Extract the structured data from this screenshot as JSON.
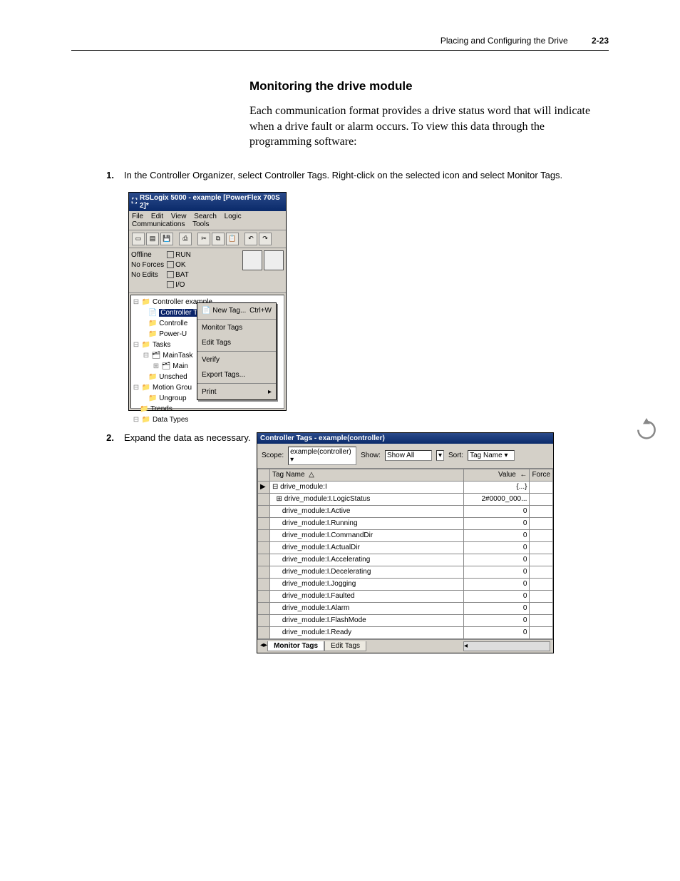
{
  "header": {
    "chapter": "Placing and Configuring the Drive",
    "page": "2-23"
  },
  "section": {
    "title": "Monitoring the drive module"
  },
  "body": {
    "p1": "Each communication format provides a drive status word that will indicate when a drive fault or alarm occurs. To view this data through the programming software:"
  },
  "steps": {
    "s1_num": "1.",
    "s1_text": "In the Controller Organizer, select Controller Tags. Right-click on the selected icon and select Monitor Tags.",
    "s2_num": "2.",
    "s2_text": "Expand the data as necessary."
  },
  "win1": {
    "title": "RSLogix 5000 - example [PowerFlex 700S 2]*",
    "menu": {
      "file": "File",
      "edit": "Edit",
      "view": "View",
      "search": "Search",
      "logic": "Logic",
      "comm": "Communications",
      "tools": "Tools"
    },
    "status": {
      "offline": "Offline",
      "noforces": "No Forces",
      "noedits": "No Edits",
      "run": "RUN",
      "ok": "OK",
      "bat": "BAT",
      "io": "I/O"
    },
    "tree": {
      "root": "Controller example",
      "ctags": "Controller Tags",
      "controllc": "Controlle",
      "poweru": "Power-U",
      "tasks": "Tasks",
      "maintask": "MainTask",
      "main": "Main",
      "unsched": "Unsched",
      "motion": "Motion Grou",
      "ungroup": "Ungroup",
      "trends": "Trends",
      "datatypes": "Data Types"
    },
    "ctx": {
      "newtag": "New Tag...",
      "newtag_sc": "Ctrl+W",
      "monitor": "Monitor Tags",
      "edit": "Edit Tags",
      "verify": "Verify",
      "export": "Export Tags...",
      "print": "Print"
    }
  },
  "win2": {
    "title": "Controller Tags - example(controller)",
    "filter": {
      "scope": "Scope:",
      "scope_val": "example(controller)",
      "show": "Show:",
      "show_val": "Show All",
      "sort": "Sort:",
      "sort_val": "Tag Name"
    },
    "cols": {
      "tagname": "Tag Name",
      "value": "Value",
      "force": "Force"
    },
    "rows": [
      {
        "name": "drive_module:I",
        "value": "{...}"
      },
      {
        "name": "drive_module:I.LogicStatus",
        "value": "2#0000_000..."
      },
      {
        "name": "drive_module:I.Active",
        "value": "0"
      },
      {
        "name": "drive_module:I.Running",
        "value": "0"
      },
      {
        "name": "drive_module:I.CommandDir",
        "value": "0"
      },
      {
        "name": "drive_module:I.ActualDir",
        "value": "0"
      },
      {
        "name": "drive_module:I.Accelerating",
        "value": "0"
      },
      {
        "name": "drive_module:I.Decelerating",
        "value": "0"
      },
      {
        "name": "drive_module:I.Jogging",
        "value": "0"
      },
      {
        "name": "drive_module:I.Faulted",
        "value": "0"
      },
      {
        "name": "drive_module:I.Alarm",
        "value": "0"
      },
      {
        "name": "drive_module:I.FlashMode",
        "value": "0"
      },
      {
        "name": "drive_module:I.Ready",
        "value": "0"
      }
    ],
    "tabs": {
      "monitor": "Monitor Tags",
      "edit": "Edit Tags"
    }
  }
}
